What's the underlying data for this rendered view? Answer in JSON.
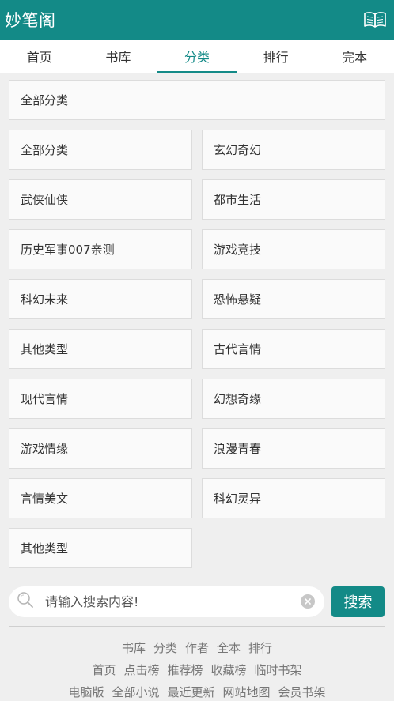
{
  "header": {
    "title": "妙笔阁",
    "icon": "open-book-icon"
  },
  "tabs": [
    {
      "label": "首页",
      "active": false
    },
    {
      "label": "书库",
      "active": false
    },
    {
      "label": "分类",
      "active": true
    },
    {
      "label": "排行",
      "active": false
    },
    {
      "label": "完本",
      "active": false
    }
  ],
  "categories": {
    "all_label": "全部分类",
    "items": [
      "全部分类",
      "玄幻奇幻",
      "武侠仙侠",
      "都市生活",
      "历史军事007亲测",
      "游戏竞技",
      "科幻未来",
      "恐怖悬疑",
      "其他类型",
      "古代言情",
      "现代言情",
      "幻想奇缘",
      "游戏情缘",
      "浪漫青春",
      "言情美文",
      "科幻灵异",
      "其他类型"
    ]
  },
  "search": {
    "placeholder": "请输入搜索内容!",
    "value": "",
    "button_label": "搜索"
  },
  "footer": {
    "row1": [
      "书库",
      "分类",
      "作者",
      "全本",
      "排行"
    ],
    "row2": [
      "首页",
      "点击榜",
      "推荐榜",
      "收藏榜",
      "临时书架"
    ],
    "row3": [
      "电脑版",
      "全部小说",
      "最近更新",
      "网站地图",
      "会员书架"
    ]
  },
  "colors": {
    "brand": "#138a87",
    "background": "#efefef",
    "cell": "#fafafa"
  }
}
